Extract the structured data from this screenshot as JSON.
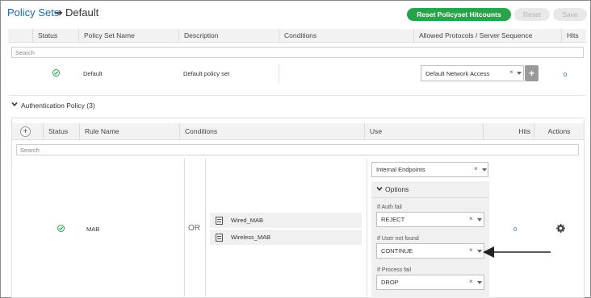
{
  "header": {
    "breadcrumb_link": "Policy Sets",
    "breadcrumb_sep": "➔",
    "breadcrumb_current": "Default",
    "reset_hitcounts": "Reset Policyset Hitcounts",
    "reset": "Reset",
    "save": "Save"
  },
  "policy_table": {
    "columns": [
      "Status",
      "Policy Set Name",
      "Description",
      "Conditions",
      "Allowed Protocols / Server Sequence",
      "Hits"
    ],
    "search_placeholder": "Search",
    "row": {
      "name": "Default",
      "description": "Default policy set",
      "allowed_protocols": "Default Network Access",
      "hits": "0"
    }
  },
  "auth_policy": {
    "title": "Authentication Policy (3)",
    "columns": [
      "Status",
      "Rule Name",
      "Conditions",
      "Use",
      "Hits",
      "Actions"
    ],
    "search_placeholder": "Search",
    "rule": {
      "name": "MAB",
      "operator": "OR",
      "conditions": [
        "Wired_MAB",
        "Wireless_MAB"
      ],
      "identity_source": "Internal Endpoints",
      "options_label": "Options",
      "if_auth_fail_label": "If Auth fail",
      "if_auth_fail_value": "REJECT",
      "if_user_not_found_label": "If User not found",
      "if_user_not_found_value": "CONTINUE",
      "if_process_fail_label": "If Process fail",
      "if_process_fail_value": "DROP",
      "hits": "0"
    }
  },
  "icons": {
    "clear": "×",
    "plus": "+"
  }
}
